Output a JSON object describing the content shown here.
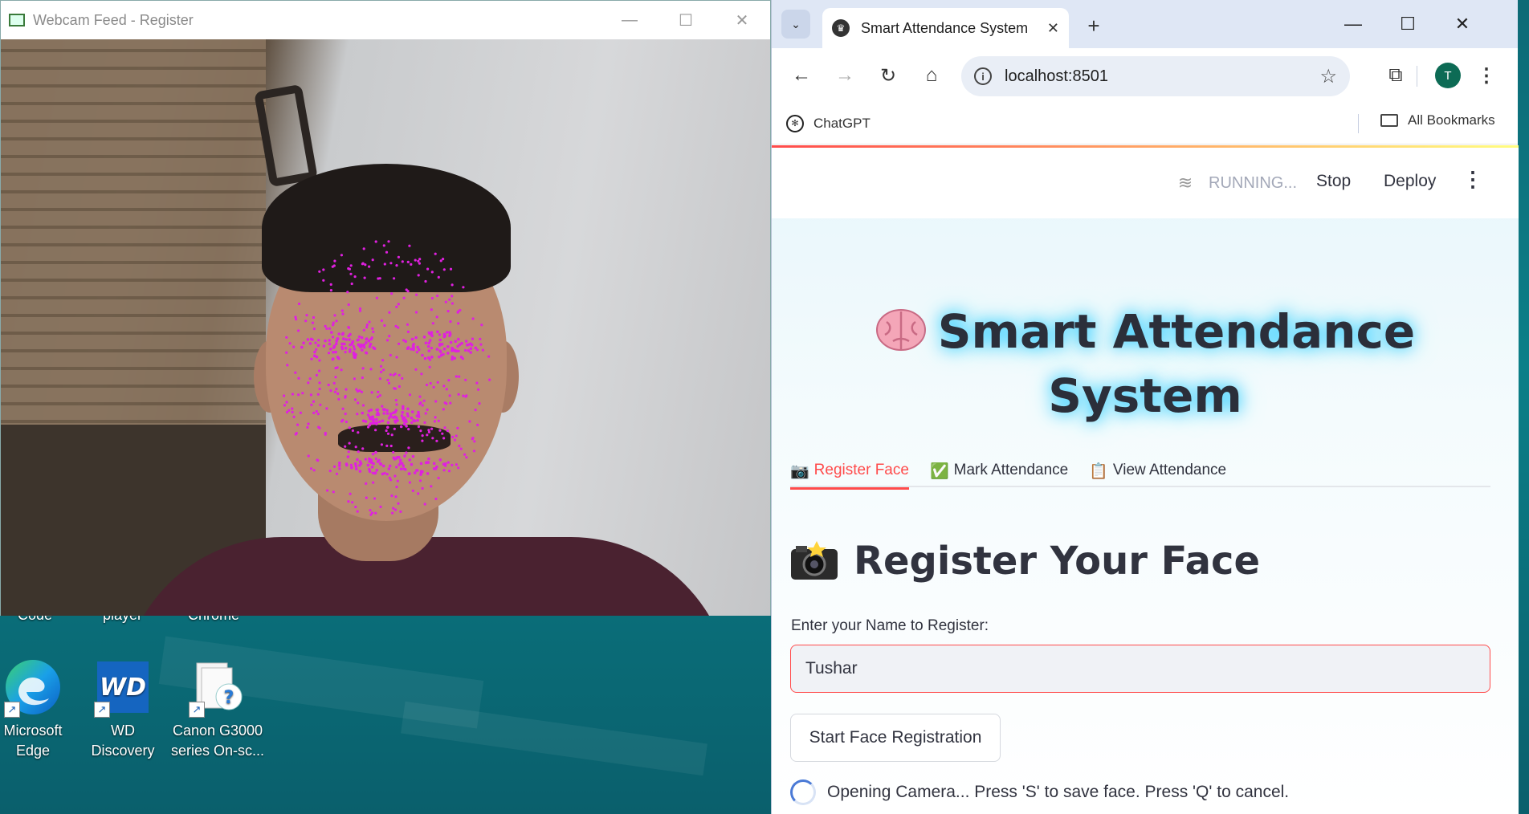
{
  "desktop": {
    "partial_labels": [
      "Code",
      "player",
      "Chrome"
    ],
    "icons": [
      {
        "label_line1": "Microsoft",
        "label_line2": "Edge"
      },
      {
        "label_line1": "WD",
        "label_line2": "Discovery"
      },
      {
        "label_line1": "Canon G3000",
        "label_line2": "series On-sc..."
      }
    ]
  },
  "webcam_window": {
    "title": "Webcam Feed - Register",
    "minimize": "—",
    "maximize": "☐",
    "close": "✕",
    "landmark_color": "#e020e0"
  },
  "browser": {
    "tab_title": "Smart Attendance System",
    "tab_close": "✕",
    "new_tab": "+",
    "url": "localhost:8501",
    "avatar_letter": "T",
    "bookmarks": {
      "chatgpt": "ChatGPT",
      "all_bookmarks": "All Bookmarks"
    },
    "controls": {
      "minimize": "—",
      "maximize": "☐",
      "close": "✕"
    }
  },
  "app": {
    "status": "RUNNING...",
    "stop_label": "Stop",
    "deploy_label": "Deploy",
    "hero_line1": "Smart Attendance",
    "hero_line2": "System",
    "tabs": [
      {
        "icon": "📷",
        "label": "Register Face",
        "active": true
      },
      {
        "icon": "✅",
        "label": "Mark Attendance",
        "active": false
      },
      {
        "icon": "📋",
        "label": "View Attendance",
        "active": false
      }
    ],
    "section_title": "Register Your Face",
    "name_label": "Enter your Name to Register:",
    "name_value": "Tushar",
    "start_button": "Start Face Registration",
    "spinner_text": "Opening Camera... Press 'S' to save face. Press 'Q' to cancel.",
    "accent_color": "#ff4b4b"
  }
}
